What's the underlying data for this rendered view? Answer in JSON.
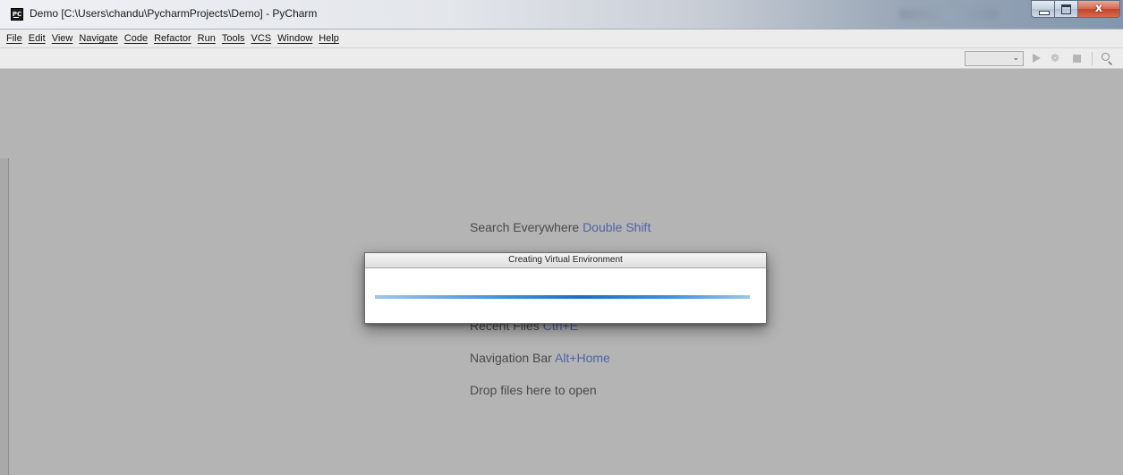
{
  "window": {
    "title": "Demo [C:\\Users\\chandu\\PycharmProjects\\Demo] - PyCharm",
    "app_icon_label": "PC",
    "controls": {
      "minimize_icon": "minimize-icon",
      "maximize_icon": "maximize-icon",
      "close_glyph": "x"
    }
  },
  "menu": {
    "items": [
      "File",
      "Edit",
      "View",
      "Navigate",
      "Code",
      "Refactor",
      "Run",
      "Tools",
      "VCS",
      "Window",
      "Help"
    ]
  },
  "toolbar": {
    "run_config_value": "",
    "icons": [
      "run-icon",
      "debug-icon",
      "stop-icon",
      "search-icon"
    ]
  },
  "editor": {
    "hints": [
      {
        "label": "Search Everywhere ",
        "shortcut": "Double Shift"
      },
      {
        "label": "Recent Files ",
        "shortcut": "Ctrl+E"
      },
      {
        "label": "Navigation Bar ",
        "shortcut": "Alt+Home"
      },
      {
        "label": "Drop files here to open",
        "shortcut": ""
      }
    ]
  },
  "dialog": {
    "title": "Creating Virtual Environment",
    "progress": 1.0
  },
  "colors": {
    "editor_background": "#b4b4b4",
    "shortcut_text": "#4f63a6",
    "progress_blue": "#1d6fc8",
    "close_button": "#c0442a"
  }
}
